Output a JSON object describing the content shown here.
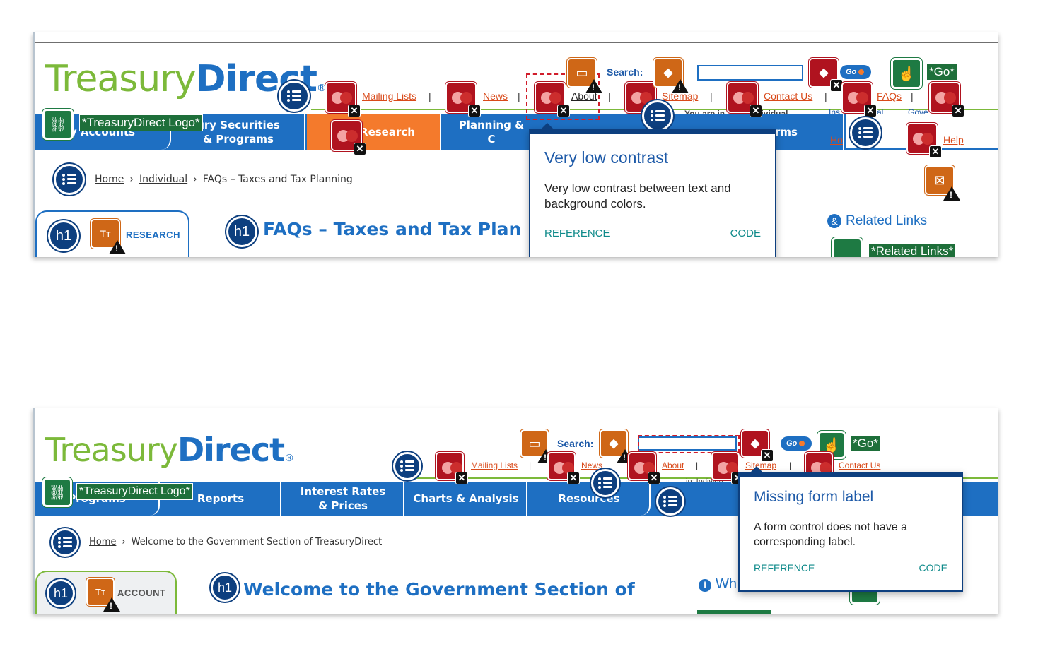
{
  "panel1": {
    "logo": {
      "treasury": "Treasury",
      "direct": "Direct",
      "reg": "®"
    },
    "top_links": [
      "Mailing Lists",
      "News",
      "About",
      "Sitemap",
      "Contact Us",
      "FAQs"
    ],
    "search_label": "Search:",
    "go_label": "Go",
    "logo_alt_label": "*TreasuryDirect Logo*",
    "go_alt_label": "*Go*",
    "related_alt_label": "*Related Links*",
    "nav_tabs": [
      "y Accounts",
      "ury Securities\n& Programs",
      "Research",
      "Planning & C",
      "rms"
    ],
    "you_are_in": "You are in",
    "you_are_in_value": "Individual",
    "partial_links": [
      "Ins",
      "al",
      "Gove"
    ],
    "home_help": [
      "Ho",
      "Help"
    ],
    "breadcrumb": {
      "home": "Home",
      "individual": "Individual",
      "current": "FAQs – Taxes and Tax Planning"
    },
    "sidebar_title": "RESEARCH",
    "page_title": "FAQs – Taxes and Tax Plan",
    "related_links": "Related Links",
    "tooltip": {
      "title": "Very low contrast",
      "body": "Very low contrast between text and background colors.",
      "reference": "REFERENCE",
      "code": "CODE"
    }
  },
  "panel2": {
    "logo": {
      "treasury": "Treasury",
      "direct": "Direct",
      "reg": "®"
    },
    "top_links": [
      "Mailing Lists",
      "News",
      "About",
      "Sitemap",
      "Contact Us"
    ],
    "search_label": "Search:",
    "go_label": "Go",
    "logo_alt_label": "*TreasuryDirect Logo*",
    "go_alt_label": "*Go*",
    "nav_tabs": [
      "Programs",
      "Reports",
      "Interest Rates\n& Prices",
      "Charts & Analysis",
      "Resources"
    ],
    "you_are_in_partial": "in: Individu",
    "breadcrumb": {
      "home": "Home",
      "current": "Welcome to the Government Section of TreasuryDirect"
    },
    "sidebar_title": "ACCOUNT",
    "page_title": "Welcome to the Government Section of",
    "side_heading": "Wh",
    "tooltip": {
      "title": "Missing form label",
      "body": "A form control does not have a corresponding label.",
      "reference": "REFERENCE",
      "code": "CODE"
    }
  },
  "icons": {
    "list": "list-icon",
    "heading": "h1-icon",
    "error": "error-icon",
    "warning": "warning-icon",
    "tag": "tag-icon",
    "link": "link-icon",
    "touch": "touch-icon",
    "text-size": "text-size-icon",
    "close": "close-icon"
  },
  "colors": {
    "brand_blue": "#1e6fc2",
    "brand_green": "#7cb93a",
    "active_tab": "#f47a2c",
    "error_red": "#b0131f",
    "warning_orange": "#cf6717",
    "alt_green": "#1e7a43",
    "badge_navy": "#0d3f7f",
    "link_teal": "#0e8a8a"
  }
}
